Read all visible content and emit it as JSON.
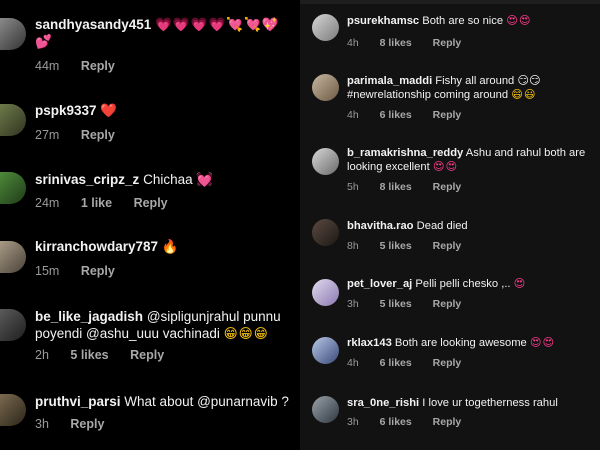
{
  "left_comments": [
    {
      "username": "sandhyasandy451",
      "text": "",
      "emoji": "💗💗💗💗💘💘💖💕",
      "time": "44m",
      "likes": "",
      "reply": "Reply"
    },
    {
      "username": "pspk9337",
      "text": "",
      "emoji": "❤️",
      "time": "27m",
      "likes": "",
      "reply": "Reply"
    },
    {
      "username": "srinivas_cripz_z",
      "text": "Chichaa",
      "emoji": "💓",
      "time": "24m",
      "likes": "1 like",
      "reply": "Reply"
    },
    {
      "username": "kirranchowdary787",
      "text": "",
      "emoji": "🔥",
      "time": "15m",
      "likes": "",
      "reply": "Reply"
    },
    {
      "username": "be_like_jagadish",
      "text": "@sipligunjrahul punnu poyendi @ashu_uuu vachinadi",
      "emoji": "😁😁😁",
      "time": "2h",
      "likes": "5 likes",
      "reply": "Reply"
    },
    {
      "username": "pruthvi_parsi",
      "text": "What about @punarnavib ?",
      "emoji": "",
      "time": "3h",
      "likes": "",
      "reply": "Reply"
    }
  ],
  "right_comments": [
    {
      "username": "psurekhamsc",
      "text": "Both are so nice",
      "emoji": "😍😍",
      "time": "4h",
      "likes": "8 likes",
      "reply": "Reply"
    },
    {
      "username": "parimala_maddi",
      "text": "Fishy all around 😏😏 #newrelationship coming around",
      "emoji": "😄😃",
      "time": "4h",
      "likes": "6 likes",
      "reply": "Reply"
    },
    {
      "username": "b_ramakrishna_reddy",
      "text": "Ashu and rahul both are looking excellent",
      "emoji": "😍😍",
      "time": "5h",
      "likes": "8 likes",
      "reply": "Reply"
    },
    {
      "username": "bhavitha.rao",
      "text": "Dead died",
      "emoji": "",
      "time": "8h",
      "likes": "5 likes",
      "reply": "Reply"
    },
    {
      "username": "pet_lover_aj",
      "text": "Pelli pelli chesko ,..",
      "emoji": "😍",
      "time": "3h",
      "likes": "5 likes",
      "reply": "Reply"
    },
    {
      "username": "rklax143",
      "text": "Both are looking awesome",
      "emoji": "😍😍",
      "time": "4h",
      "likes": "6 likes",
      "reply": "Reply"
    },
    {
      "username": "sra_0ne_rishi",
      "text": "I love ur togetherness rahul",
      "emoji": "",
      "time": "3h",
      "likes": "6 likes",
      "reply": "Reply"
    }
  ]
}
